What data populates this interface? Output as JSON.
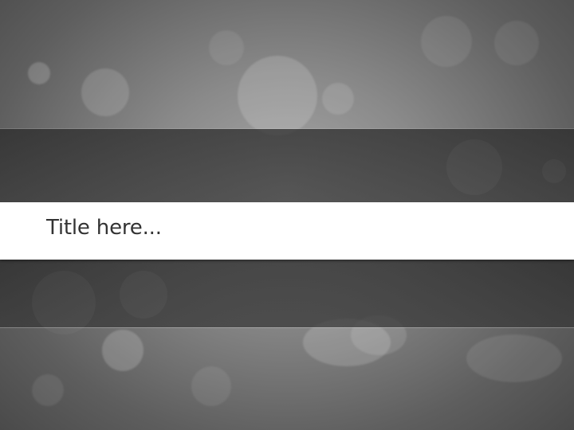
{
  "slide": {
    "title_placeholder": "Title here...",
    "colors": {
      "background": "#8a8a8a",
      "band": "#3e3e3e",
      "title_bar": "#ffffff",
      "title_text": "#333333"
    }
  }
}
